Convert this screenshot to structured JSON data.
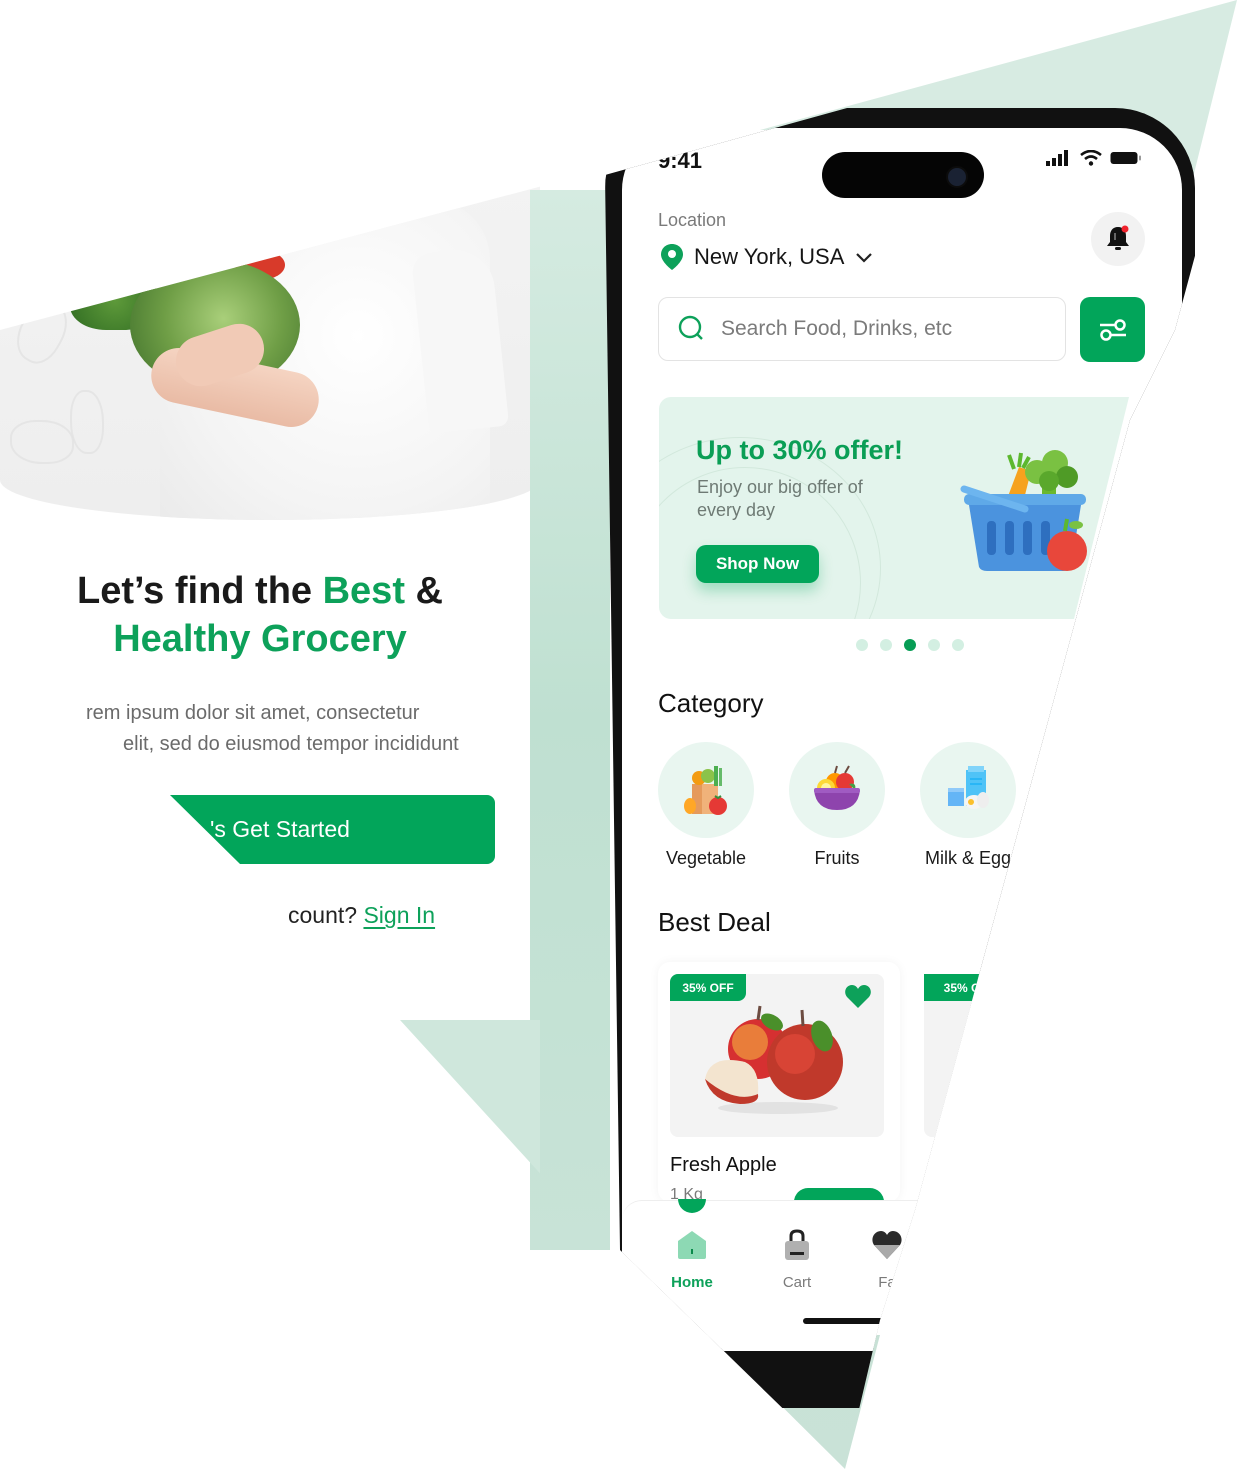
{
  "onboarding": {
    "headline_line1_part1": "Let’s find the ",
    "headline_line1_highlight": "Best",
    "headline_line1_part2": " &",
    "headline_line2": "Healthy Grocery",
    "body_line1": "rem ipsum dolor sit amet, consectetur",
    "body_line2": "elit, sed do eiusmod tempor incididunt",
    "cta_label": "'s Get Started",
    "signin_prompt": "count?",
    "signin_link": "Sign In"
  },
  "status_bar": {
    "time": "9:41"
  },
  "header": {
    "location_label": "Location",
    "location_value": "New York, USA",
    "notification_badge": true
  },
  "search": {
    "placeholder": "Search Food, Drinks, etc",
    "value": ""
  },
  "banner": {
    "title": "Up to 30% offer!",
    "subtitle": "Enjoy our big offer of every day",
    "button_label": "Shop Now",
    "carousel": {
      "total": 5,
      "active_index": 2
    }
  },
  "categories": {
    "title": "Category",
    "items": [
      {
        "label": "Vegetable",
        "icon": "vegetable-bag-icon"
      },
      {
        "label": "Fruits",
        "icon": "fruit-bowl-icon"
      },
      {
        "label": "Milk & Egg",
        "icon": "milk-egg-icon"
      }
    ]
  },
  "best_deal": {
    "title": "Best Deal",
    "products": [
      {
        "name": "Fresh Apple",
        "quantity": "1 Kg",
        "badge": "35% OFF",
        "favorite": true
      },
      {
        "name": "",
        "quantity": "",
        "badge": "35% O",
        "favorite": false
      }
    ]
  },
  "tabbar": {
    "tabs": [
      {
        "label": "Home",
        "icon": "home-icon",
        "active": true
      },
      {
        "label": "Cart",
        "icon": "cart-bag-icon",
        "active": false
      },
      {
        "label": "Fa",
        "icon": "favorite-icon",
        "active": false
      }
    ]
  },
  "colors": {
    "brand_green": "#02a55a",
    "text_green": "#0da15a",
    "mint_bg": "#e3f4ec",
    "dot_inactive": "#d3efe2"
  }
}
